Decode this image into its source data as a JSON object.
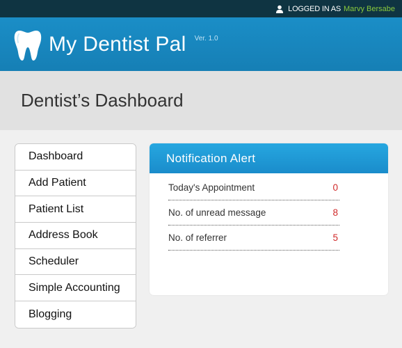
{
  "topbar": {
    "logged_in_label": "LOGGED IN AS",
    "username": "Marvy Bersabe",
    "user_icon": "user-icon",
    "username_color": "#8ac93d"
  },
  "brand": {
    "logo_icon": "tooth-icon",
    "title": "My Dentist Pal",
    "version": "Ver. 1.0"
  },
  "page": {
    "title": "Dentist’s Dashboard"
  },
  "sidebar": {
    "items": [
      {
        "label": "Dashboard"
      },
      {
        "label": "Add Patient"
      },
      {
        "label": "Patient List"
      },
      {
        "label": "Address Book"
      },
      {
        "label": "Scheduler"
      },
      {
        "label": "Simple Accounting"
      },
      {
        "label": "Blogging"
      }
    ]
  },
  "notification": {
    "header": "Notification Alert",
    "rows": [
      {
        "label": "Today's Appointment",
        "value": "0"
      },
      {
        "label": "No. of unread message",
        "value": "8"
      },
      {
        "label": "No. of referrer",
        "value": "5"
      }
    ]
  },
  "colors": {
    "topbar": "#0f3442",
    "brand": "#1a8ec7",
    "value_red": "#d02a2a"
  }
}
